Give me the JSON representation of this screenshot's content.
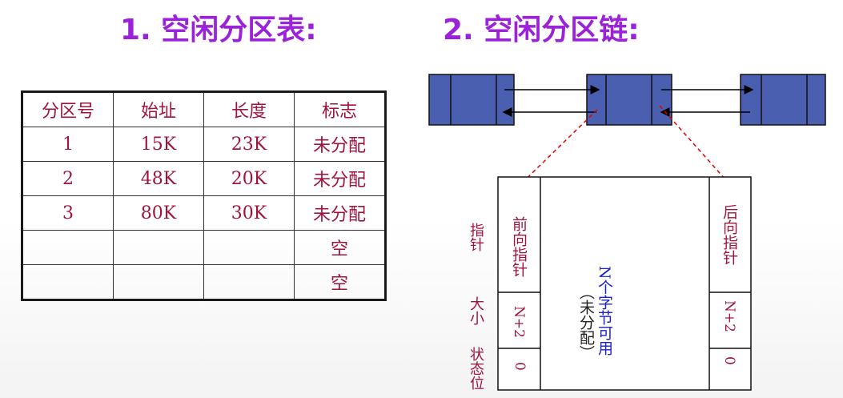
{
  "titles": {
    "table_title": "1. 空闲分区表:",
    "chain_title": "2. 空闲分区链:"
  },
  "table": {
    "headers": [
      "分区号",
      "始址",
      "长度",
      "标志"
    ],
    "rows": [
      [
        "1",
        "15K",
        "23K",
        "未分配"
      ],
      [
        "2",
        "48K",
        "20K",
        "未分配"
      ],
      [
        "3",
        "80K",
        "30K",
        "未分配"
      ],
      [
        "",
        "",
        "",
        "空"
      ],
      [
        "",
        "",
        "",
        "空"
      ]
    ]
  },
  "partition": {
    "front_pointer": "前向指针",
    "back_pointer": "后向指针",
    "size_left": "N+2",
    "size_right": "N+2",
    "status_left": "0",
    "status_right": "0",
    "center_main": "N个字节可用",
    "center_sub": "（未分配）"
  },
  "side_labels": {
    "pointer": "指针",
    "size": "大小",
    "status": "状态位"
  },
  "colors": {
    "title": "#9b22d8",
    "table_text": "#a0143c",
    "node_fill": "#4a5fb0",
    "arrow_red": "#e00000",
    "center_blue": "#1b22c8"
  }
}
